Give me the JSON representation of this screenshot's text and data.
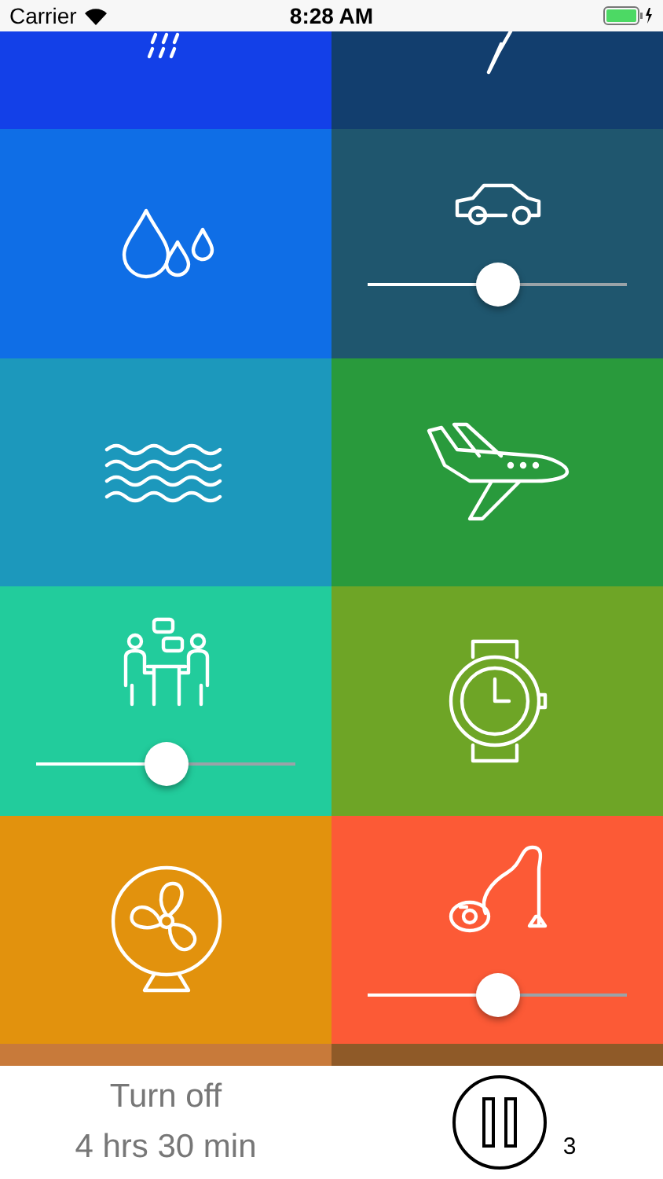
{
  "status_bar": {
    "carrier": "Carrier",
    "time": "8:28 AM"
  },
  "tiles": [
    {
      "kind": "rain",
      "color": "#1340e8"
    },
    {
      "kind": "lightning",
      "color": "#123e6e"
    },
    {
      "kind": "drops",
      "color": "#0f6ee6"
    },
    {
      "kind": "car",
      "color": "#1f566e",
      "level": 0.5
    },
    {
      "kind": "waves",
      "color": "#1c98bc"
    },
    {
      "kind": "plane",
      "color": "#299a3c"
    },
    {
      "kind": "meeting",
      "color": "#22cc9c",
      "level": 0.5
    },
    {
      "kind": "watch",
      "color": "#6ea526"
    },
    {
      "kind": "fan",
      "color": "#e2920d"
    },
    {
      "kind": "vacuum",
      "color": "#fc5a36",
      "level": 0.5
    },
    {
      "kind": "blank",
      "color": "#c87a3a"
    },
    {
      "kind": "blank",
      "color": "#8f5a28"
    }
  ],
  "timer": {
    "label": "Turn off",
    "duration": "4 hrs 30 min"
  },
  "pause_button": {
    "count": "3"
  }
}
